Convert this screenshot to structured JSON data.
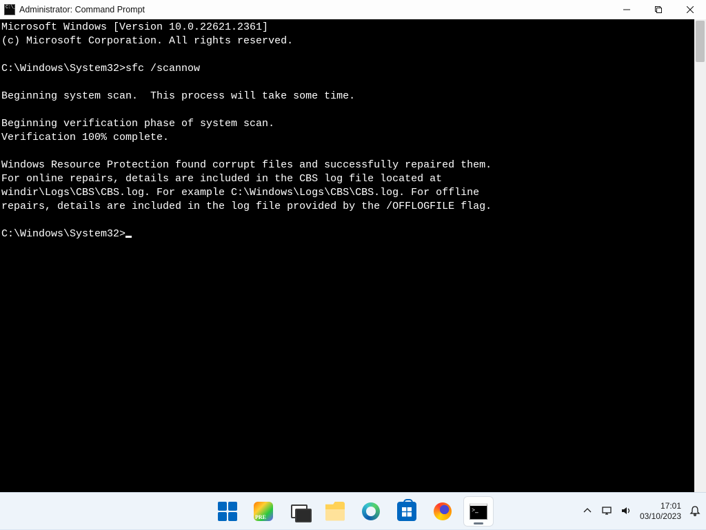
{
  "window": {
    "title": "Administrator: Command Prompt"
  },
  "console": {
    "lines": [
      "Microsoft Windows [Version 10.0.22621.2361]",
      "(c) Microsoft Corporation. All rights reserved.",
      "",
      "C:\\Windows\\System32>sfc /scannow",
      "",
      "Beginning system scan.  This process will take some time.",
      "",
      "Beginning verification phase of system scan.",
      "Verification 100% complete.",
      "",
      "Windows Resource Protection found corrupt files and successfully repaired them.",
      "For online repairs, details are included in the CBS log file located at",
      "windir\\Logs\\CBS\\CBS.log. For example C:\\Windows\\Logs\\CBS\\CBS.log. For offline",
      "repairs, details are included in the log file provided by the /OFFLOGFILE flag.",
      ""
    ],
    "prompt": "C:\\Windows\\System32>"
  },
  "taskbar": {
    "time": "17:01",
    "date": "03/10/2023"
  }
}
